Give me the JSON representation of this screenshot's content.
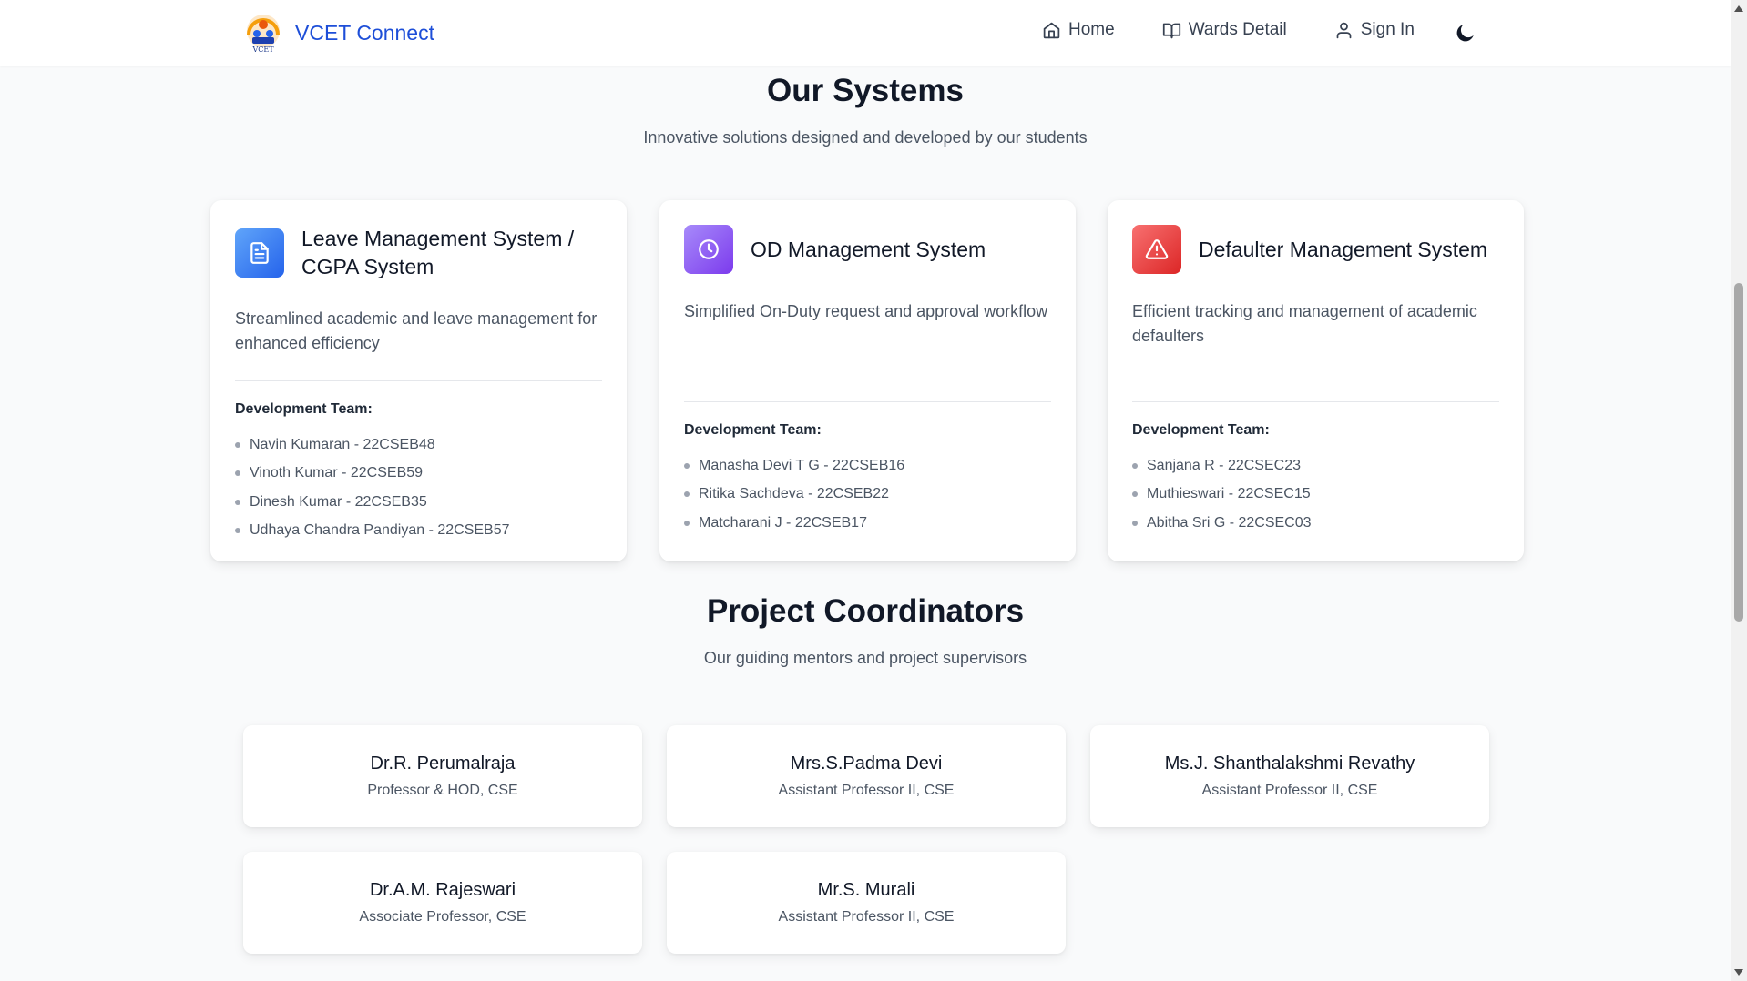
{
  "header": {
    "brand": "VCET Connect",
    "nav": [
      {
        "label": "Home",
        "icon": "home-icon"
      },
      {
        "label": "Wards Detail",
        "icon": "book-icon"
      },
      {
        "label": "Sign In",
        "icon": "user-icon"
      }
    ],
    "theme_toggle_icon": "moon-icon"
  },
  "systems": {
    "title": "Our Systems",
    "subtitle": "Innovative solutions designed and developed by our students",
    "team_heading": "Development Team:",
    "cards": [
      {
        "title": "Leave Management System / CGPA System",
        "description": "Streamlined academic and leave management for enhanced efficiency",
        "icon": "document-icon",
        "icon_color": "#3b82f6",
        "team": [
          "Navin Kumaran - 22CSEB48",
          "Vinoth Kumar - 22CSEB59",
          "Dinesh Kumar - 22CSEB35",
          "Udhaya Chandra Pandiyan - 22CSEB57"
        ]
      },
      {
        "title": "OD Management System",
        "description": "Simplified On-Duty request and approval workflow",
        "icon": "clock-icon",
        "icon_color": "#8b5cf6",
        "team": [
          "Manasha Devi T G - 22CSEB16",
          "Ritika Sachdeva - 22CSEB22",
          "Matcharani J - 22CSEB17"
        ]
      },
      {
        "title": "Defaulter Management System",
        "description": "Efficient tracking and management of academic defaulters",
        "icon": "alert-triangle-icon",
        "icon_color": "#ef4444",
        "team": [
          "Sanjana R - 22CSEC23",
          "Muthieswari - 22CSEC15",
          "Abitha Sri G - 22CSEC03"
        ]
      }
    ]
  },
  "coordinators": {
    "title": "Project Coordinators",
    "subtitle": "Our guiding mentors and project supervisors",
    "people": [
      {
        "name": "Dr.R. Perumalraja",
        "role": "Professor & HOD, CSE"
      },
      {
        "name": "Mrs.S.Padma Devi",
        "role": "Assistant Professor II, CSE"
      },
      {
        "name": "Ms.J. Shanthalakshmi Revathy",
        "role": "Assistant Professor II, CSE"
      },
      {
        "name": "Dr.A.M. Rajeswari",
        "role": "Associate Professor, CSE"
      },
      {
        "name": "Mr.S. Murali",
        "role": "Assistant Professor II, CSE"
      }
    ]
  }
}
